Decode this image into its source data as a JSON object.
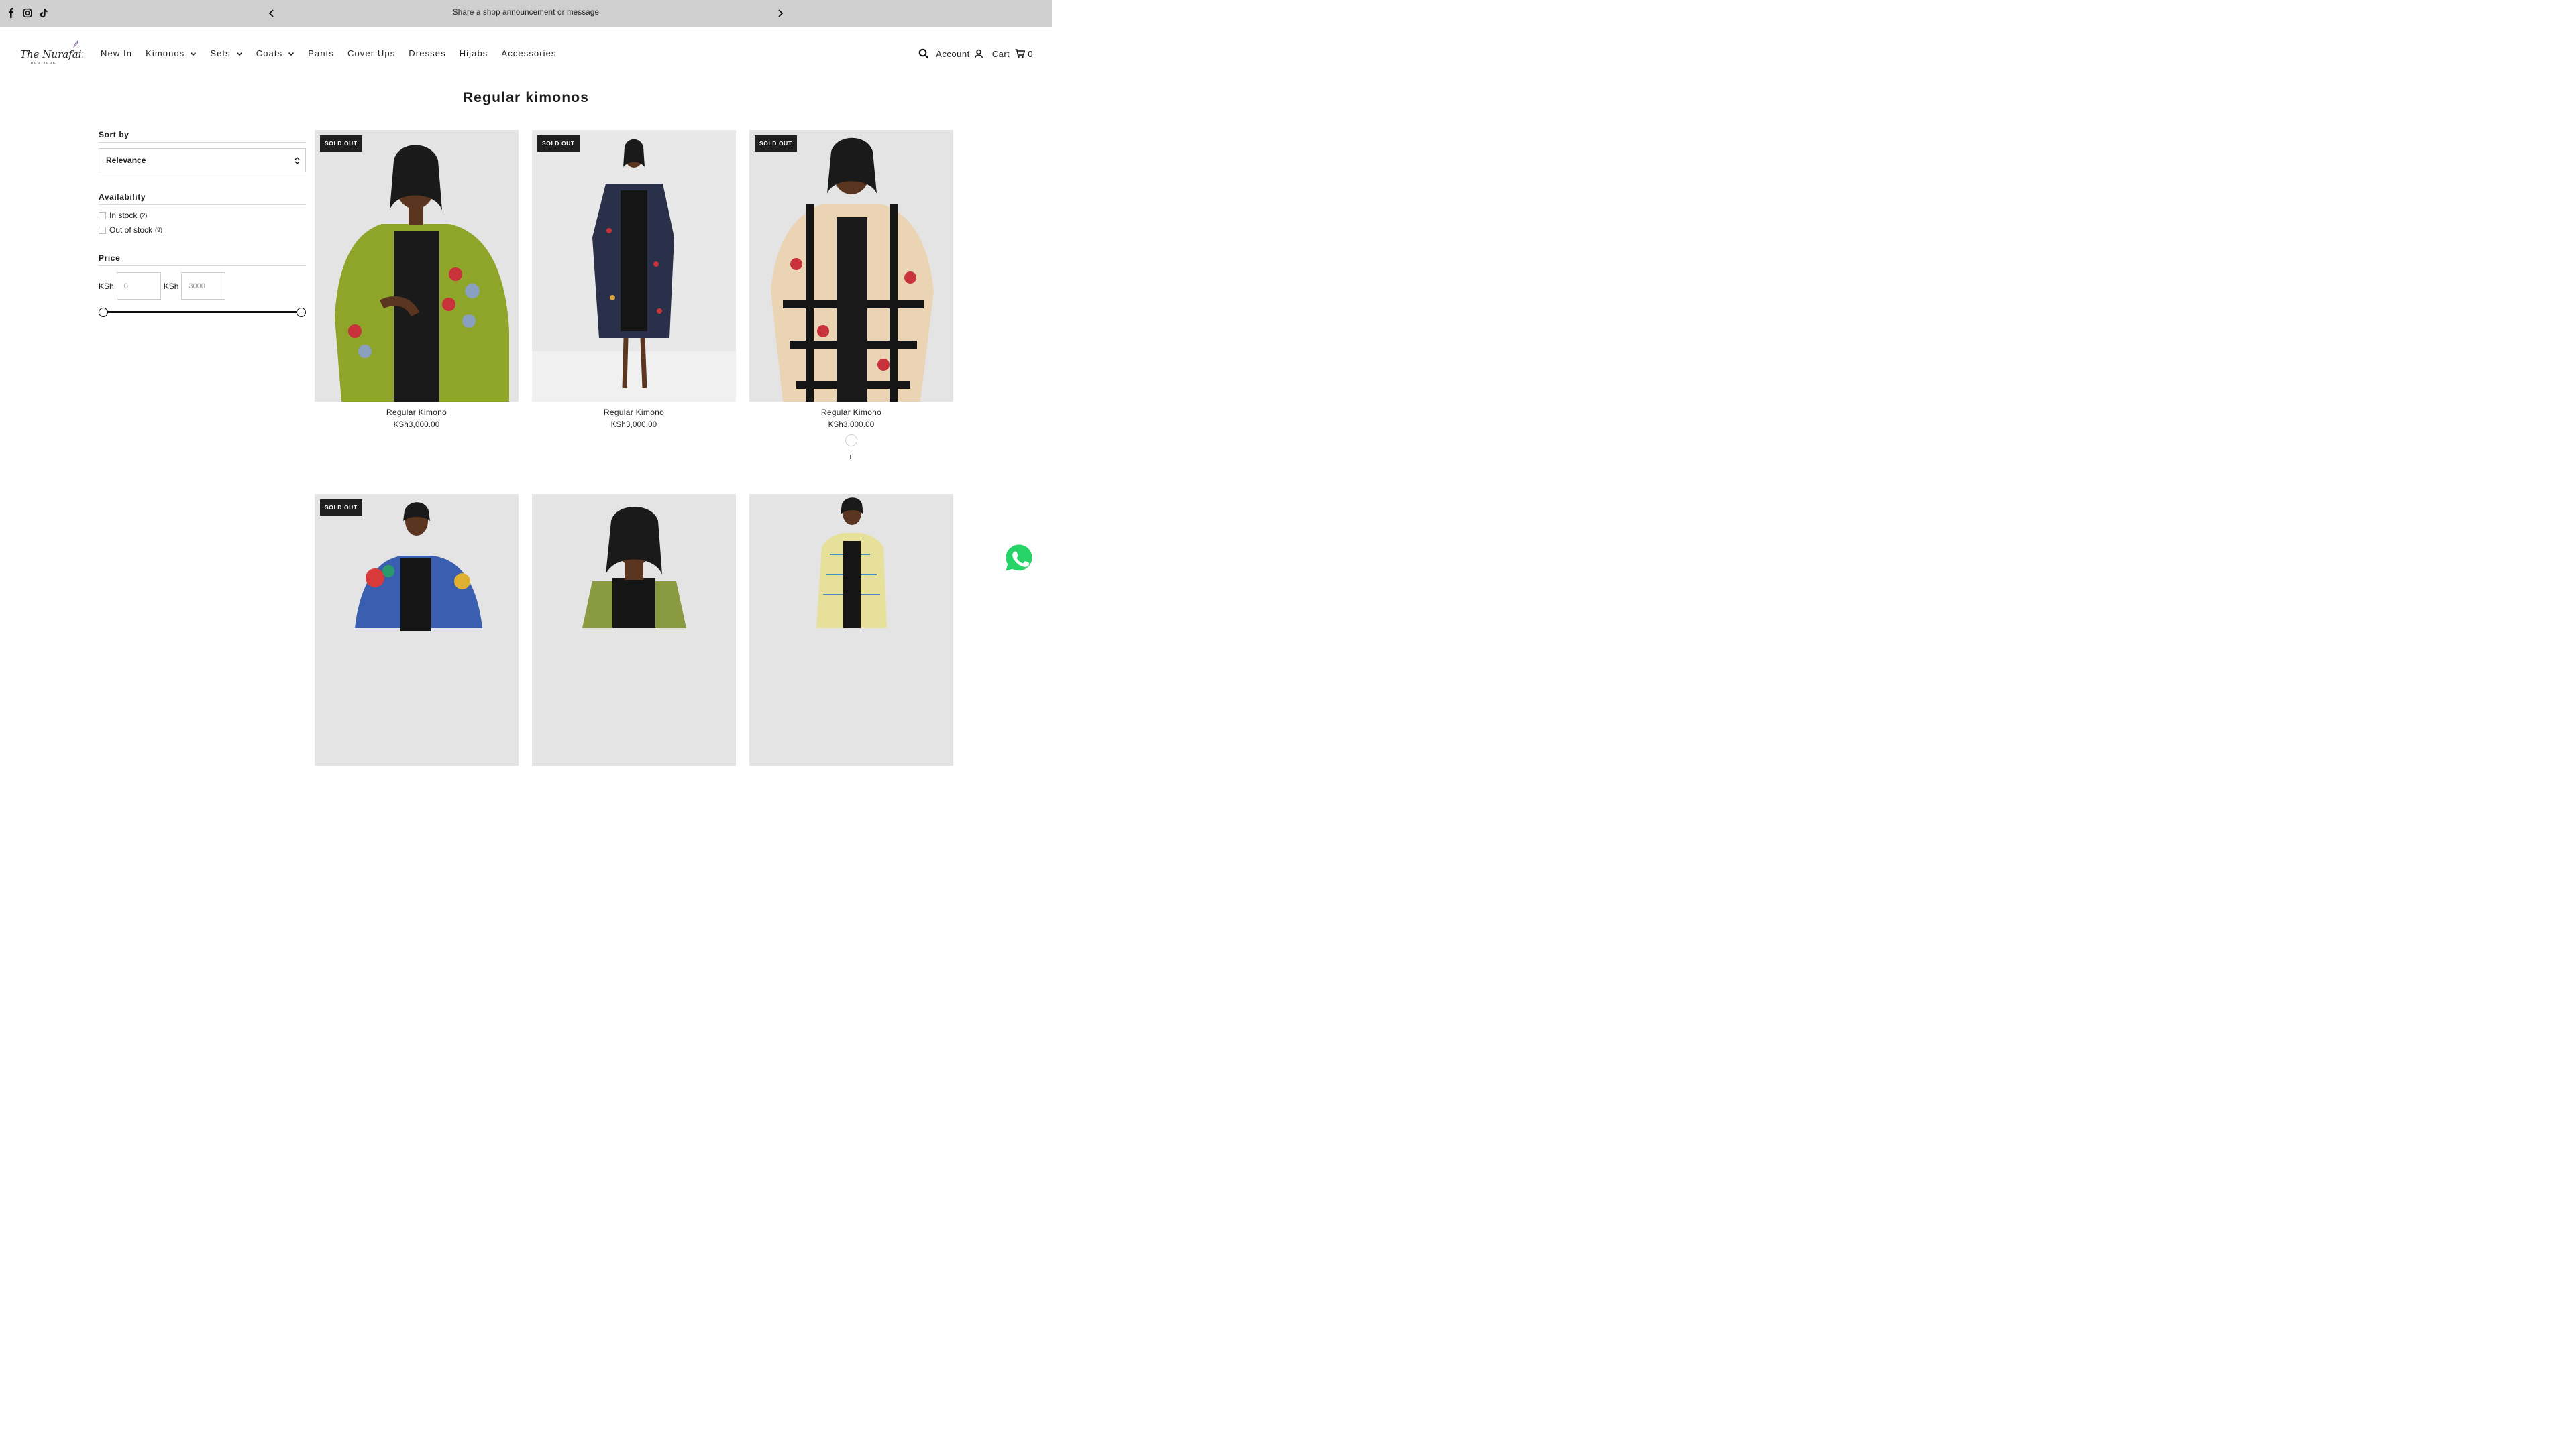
{
  "announcement": {
    "text": "Share a shop announcement or message",
    "social": [
      "facebook-icon",
      "instagram-icon",
      "tiktok-icon"
    ]
  },
  "brand": {
    "logo_script": "The Nurafains",
    "logo_sub": "BOUTIQUE"
  },
  "nav": {
    "items": [
      {
        "label": "New In",
        "dropdown": false
      },
      {
        "label": "Kimonos",
        "dropdown": true
      },
      {
        "label": "Sets",
        "dropdown": true
      },
      {
        "label": "Coats",
        "dropdown": true
      },
      {
        "label": "Pants",
        "dropdown": false
      },
      {
        "label": "Cover Ups",
        "dropdown": false
      },
      {
        "label": "Dresses",
        "dropdown": false
      },
      {
        "label": "Hijabs",
        "dropdown": false
      },
      {
        "label": "Accessories",
        "dropdown": false
      }
    ]
  },
  "header": {
    "account_label": "Account",
    "cart_label": "Cart",
    "cart_count": "0"
  },
  "page": {
    "title": "Regular kimonos"
  },
  "filters": {
    "sort_heading": "Sort by",
    "sort_value": "Relevance",
    "availability_heading": "Availability",
    "availability": [
      {
        "label": "In stock",
        "count": "(2)"
      },
      {
        "label": "Out of stock",
        "count": "(9)"
      }
    ],
    "price_heading": "Price",
    "currency": "KSh",
    "min_placeholder": "0",
    "max_placeholder": "3000"
  },
  "products": [
    {
      "name": "Regular Kimono",
      "price": "KSh3,000.00",
      "badge": "SOLD OUT"
    },
    {
      "name": "Regular Kimono",
      "price": "KSh3,000.00",
      "badge": "SOLD OUT"
    },
    {
      "name": "Regular Kimono",
      "price": "KSh3,000.00",
      "badge": "SOLD OUT",
      "size": "F"
    },
    {
      "badge": "SOLD OUT"
    },
    {},
    {}
  ],
  "colors": {
    "announcement_bg": "#cfcfcf",
    "badge_bg": "#1f1f1f",
    "whatsapp": "#25d366"
  }
}
